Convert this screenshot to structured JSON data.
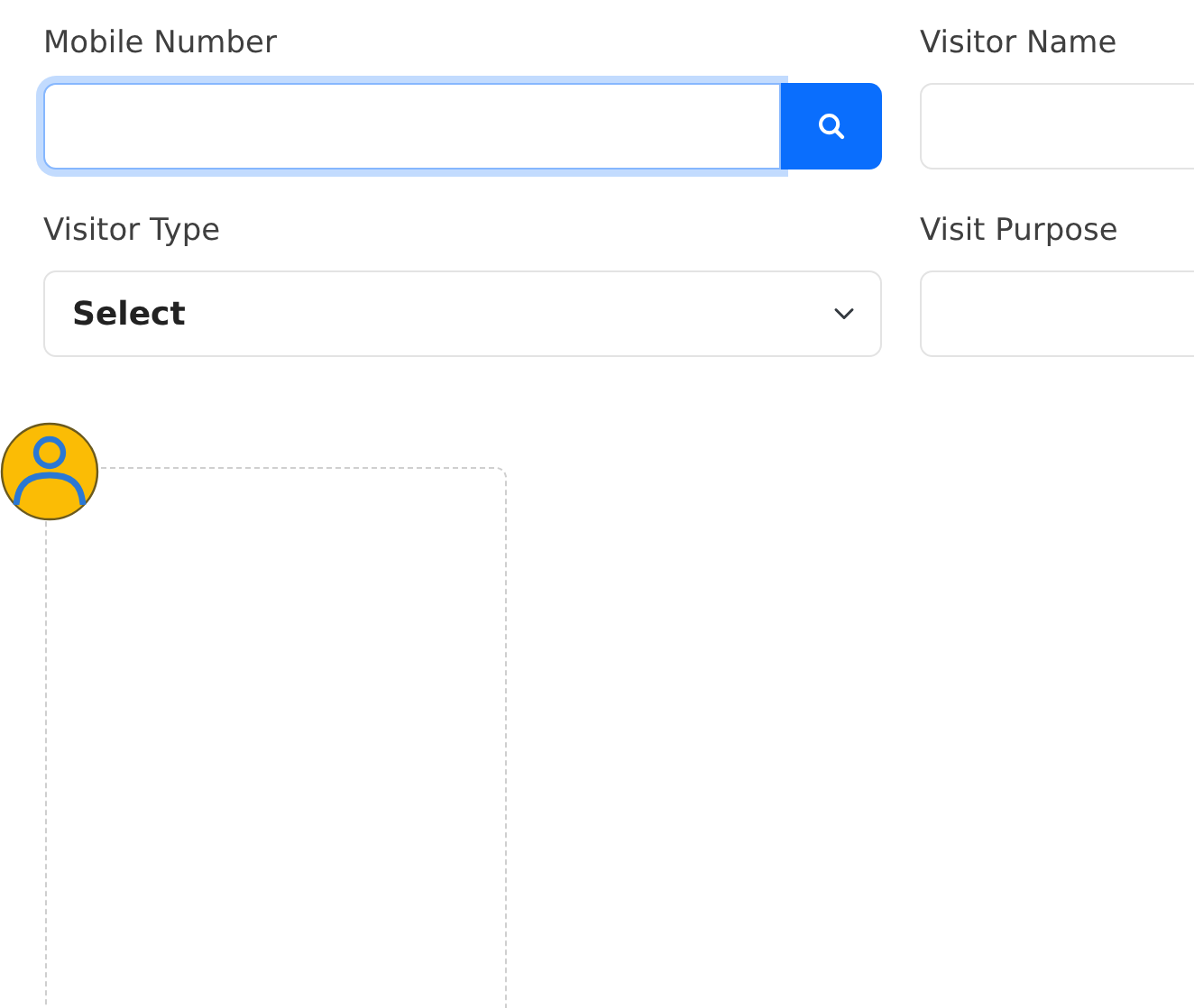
{
  "fields": [
    {
      "kind": "search",
      "label": "Mobile Number",
      "focused": true
    },
    {
      "kind": "text",
      "label": "Visitor Name",
      "focused": false
    },
    {
      "kind": "select",
      "label": "Visitor Type",
      "value": "Select",
      "focused": false
    },
    {
      "kind": "text",
      "label": "Visit Purpose",
      "focused": false
    }
  ],
  "photo": {
    "kind": "placeholder"
  }
}
